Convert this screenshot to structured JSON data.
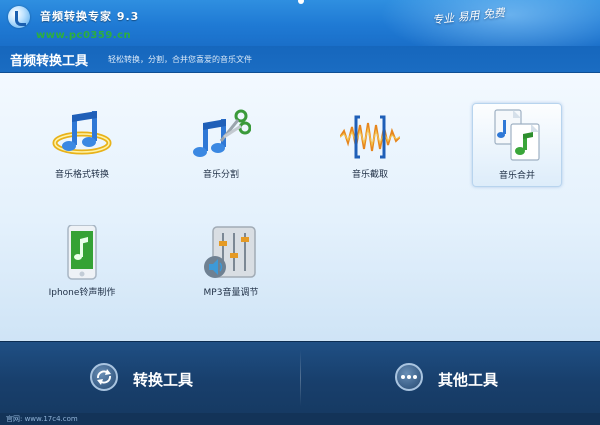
{
  "window": {
    "title": "音频转换专家 9.3",
    "slogan": "专业 易用 免费",
    "watermark": "www.pc0359.cn"
  },
  "subbar": {
    "title": "音频转换工具",
    "description": "轻松转换，分割，合并您喜爱的音乐文件"
  },
  "tools": [
    {
      "label": "音乐格式转换",
      "icon": "music-note-ring-icon",
      "selected": false
    },
    {
      "label": "音乐分割",
      "icon": "music-scissors-icon",
      "selected": false
    },
    {
      "label": "音乐截取",
      "icon": "waveform-bracket-icon",
      "selected": false
    },
    {
      "label": "音乐合并",
      "icon": "music-documents-icon",
      "selected": true
    },
    {
      "label": "Iphone铃声制作",
      "icon": "phone-music-icon",
      "selected": false
    },
    {
      "label": "MP3音量调节",
      "icon": "volume-mixer-icon",
      "selected": false
    }
  ],
  "bottom": {
    "convert_label": "转换工具",
    "other_label": "其他工具"
  },
  "footer": {
    "text": "官网: www.17c4.com"
  },
  "colors": {
    "title_bar": "#1f7ad4",
    "bottom_bar": "#183f6c",
    "accent": "#1a6cc2"
  }
}
